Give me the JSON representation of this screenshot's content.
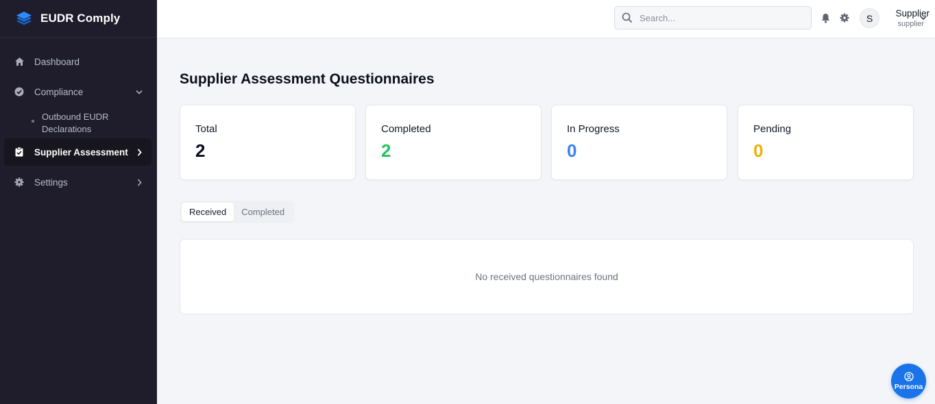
{
  "brand": {
    "name": "EUDR Comply",
    "logo_icon": "stacked-layers-icon",
    "accent": "#1a73e8"
  },
  "sidebar": {
    "items": [
      {
        "label": "Dashboard",
        "icon": "home-icon"
      },
      {
        "label": "Compliance",
        "icon": "check-circle-icon",
        "chevron": "chevron-down-icon"
      },
      {
        "label": "Outbound EUDR Declarations",
        "sub": true
      },
      {
        "label": "Supplier Assessment",
        "icon": "clipboard-check-icon",
        "chevron": "chevron-right-icon",
        "active": true
      },
      {
        "label": "Settings",
        "icon": "gear-icon",
        "chevron": "chevron-right-icon"
      }
    ]
  },
  "header": {
    "search": {
      "placeholder": "Search...",
      "value": ""
    },
    "user": {
      "initial": "S",
      "name": "Supplier",
      "role": "supplier"
    }
  },
  "main": {
    "title": "Supplier Assessment Questionnaires",
    "stats": [
      {
        "label": "Total",
        "value": "2",
        "color": "#0b0f1a"
      },
      {
        "label": "Completed",
        "value": "2",
        "color": "#22c55e"
      },
      {
        "label": "In Progress",
        "value": "0",
        "color": "#3b82f6"
      },
      {
        "label": "Pending",
        "value": "0",
        "color": "#eab308"
      }
    ],
    "tabs": [
      {
        "label": "Received",
        "active": true
      },
      {
        "label": "Completed",
        "active": false
      }
    ],
    "empty_message": "No received questionnaires found"
  },
  "persona_button": {
    "label": "Persona",
    "icon": "user-circle-icon"
  }
}
